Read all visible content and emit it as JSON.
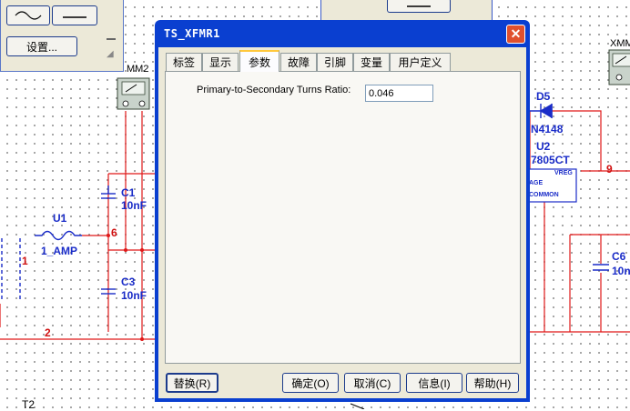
{
  "dialog": {
    "title": "TS_XFMR1",
    "close_glyph": "✕",
    "tabs": [
      {
        "label": "标签"
      },
      {
        "label": "显示"
      },
      {
        "label": "参数"
      },
      {
        "label": "故障"
      },
      {
        "label": "引脚"
      },
      {
        "label": "变量"
      },
      {
        "label": "用户定义"
      }
    ],
    "selected_tab": "参数",
    "parameter": {
      "label": "Primary-to-Secondary Turns Ratio:",
      "value": "0.046"
    },
    "buttons": {
      "replace": "替换(R)",
      "ok": "确定(O)",
      "cancel": "取消(C)",
      "info": "信息(I)",
      "help": "帮助(H)"
    }
  },
  "background_window": {
    "settings_button": "设置..."
  },
  "schematic": {
    "labels": {
      "mm2": "MM2",
      "xmm": "XMM",
      "d5": "D5",
      "d5_part": "N4148",
      "u2": "U2",
      "u2_part": "7805CT",
      "vreg": "VREG",
      "vreg_in": "AGE",
      "vreg_common": "COMMON",
      "c1": "C1",
      "c1_value": "10nF",
      "c3": "C3",
      "c3_value": "10nF",
      "c6": "C6",
      "c6_value": "10n",
      "u1": "U1",
      "u1_value": "1_AMP",
      "t2": "T2",
      "net_1": "1",
      "net_2": "2",
      "net_6": "6",
      "net_9": "9"
    }
  },
  "colors": {
    "titlebar": "#0a3fd0",
    "wire": "#e01818",
    "component": "#1a2cc8",
    "dialog_face": "#ece9d8",
    "close_button": "#e0502e"
  }
}
